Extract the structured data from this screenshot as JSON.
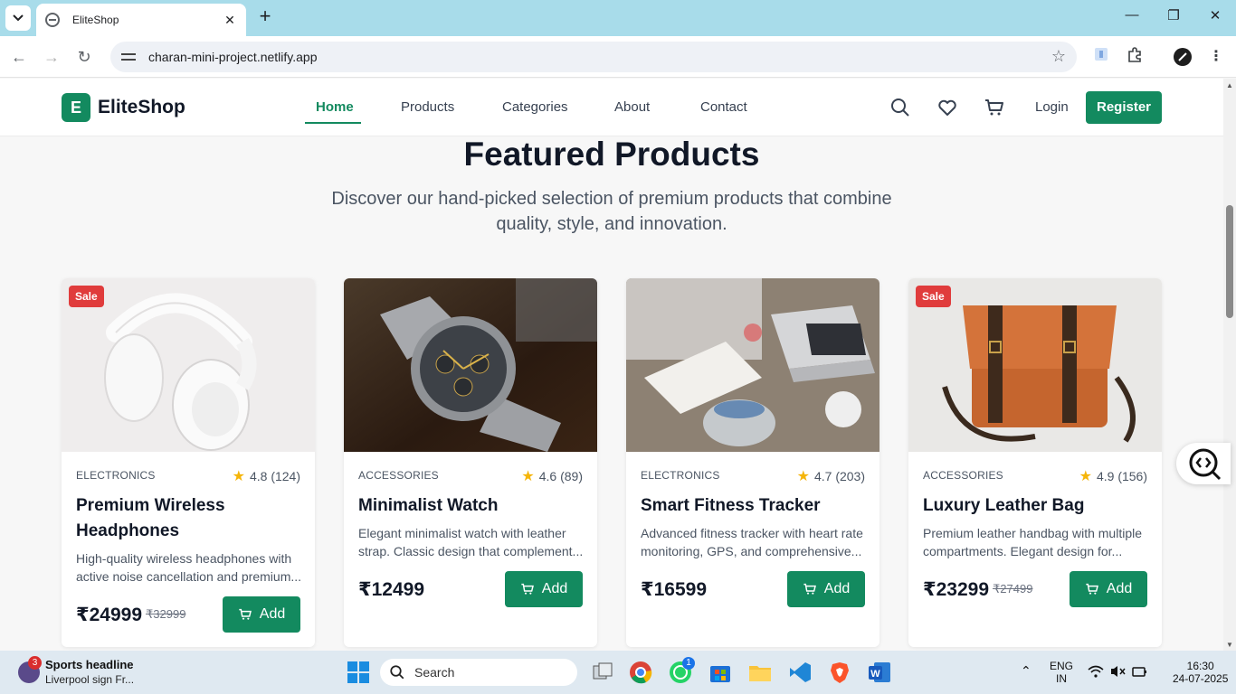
{
  "browser": {
    "tab_title": "EliteShop",
    "url": "charan-mini-project.netlify.app"
  },
  "header": {
    "logo_letter": "E",
    "brand": "EliteShop",
    "nav": [
      "Home",
      "Products",
      "Categories",
      "About",
      "Contact"
    ],
    "active_nav": "Home",
    "login": "Login",
    "register": "Register"
  },
  "section": {
    "title": "Featured Products",
    "subtitle": "Discover our hand-picked selection of premium products that combine quality, style, and innovation."
  },
  "products": [
    {
      "badge": "Sale",
      "category": "ELECTRONICS",
      "rating": "4.8",
      "reviews": "(124)",
      "name": "Premium Wireless Headphones",
      "description": "High-quality wireless headphones with active noise cancellation and premium...",
      "price": "₹24999",
      "old_price": "₹32999",
      "add": "Add",
      "image": "headphones"
    },
    {
      "badge": "",
      "category": "ACCESSORIES",
      "rating": "4.6",
      "reviews": "(89)",
      "name": "Minimalist Watch",
      "description": "Elegant minimalist watch with leather strap. Classic design that complement...",
      "price": "₹12499",
      "old_price": "",
      "add": "Add",
      "image": "watch"
    },
    {
      "badge": "",
      "category": "ELECTRONICS",
      "rating": "4.7",
      "reviews": "(203)",
      "name": "Smart Fitness Tracker",
      "description": "Advanced fitness tracker with heart rate monitoring, GPS, and comprehensive...",
      "price": "₹16599",
      "old_price": "",
      "add": "Add",
      "image": "desk-with-laptop"
    },
    {
      "badge": "Sale",
      "category": "ACCESSORIES",
      "rating": "4.9",
      "reviews": "(156)",
      "name": "Luxury Leather Bag",
      "description": "Premium leather handbag with multiple compartments. Elegant design for...",
      "price": "₹23299",
      "old_price": "₹27499",
      "add": "Add",
      "image": "leather-bag"
    }
  ],
  "taskbar": {
    "news_badge": "3",
    "news_title": "Sports headline",
    "news_sub": "Liverpool sign Fr...",
    "search": "Search",
    "whatsapp_badge": "1",
    "lang_top": "ENG",
    "lang_bottom": "IN",
    "time": "16:30",
    "date": "24-07-2025"
  },
  "colors": {
    "brand_green": "#138a5f",
    "sale_red": "#e03c3c",
    "star_yellow": "#f5b50a",
    "tab_strip": "#a8dcea"
  }
}
